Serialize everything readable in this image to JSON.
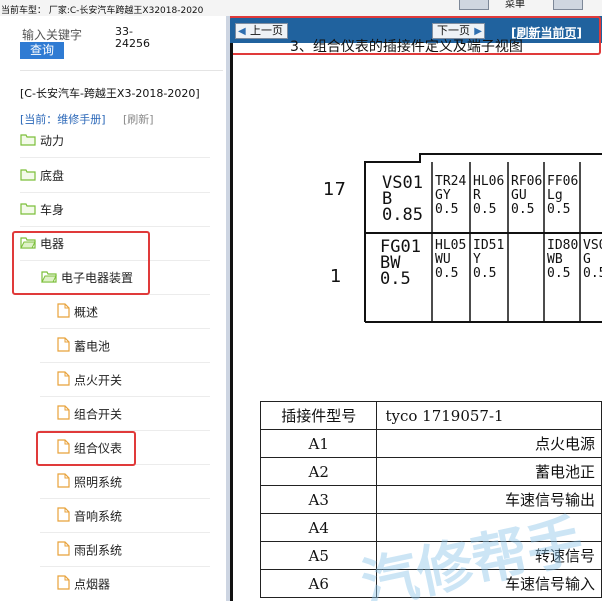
{
  "topbar": {
    "car_line": "当前车型： 厂家:C-长安汽车跨越王X32018-2020",
    "right_label": "菜单"
  },
  "sidebar": {
    "keyword_label": "输入关键字",
    "keyword_value": "33-24256",
    "search_button": "查询",
    "model": "[C-长安汽车-跨越王X3-2018-2020]",
    "current": "[当前：维修手册]",
    "refresh": "[刷新]",
    "items": [
      {
        "label": "动力",
        "level": 0,
        "icon": "folder-icon"
      },
      {
        "label": "底盘",
        "level": 0,
        "icon": "folder-icon"
      },
      {
        "label": "车身",
        "level": 0,
        "icon": "folder-icon"
      },
      {
        "label": "电器",
        "level": 0,
        "icon": "folder-open-icon"
      },
      {
        "label": "电子电器装置",
        "level": 1,
        "icon": "folder-open-icon"
      },
      {
        "label": "概述",
        "level": 2,
        "icon": "document-icon"
      },
      {
        "label": "蓄电池",
        "level": 2,
        "icon": "document-icon"
      },
      {
        "label": "点火开关",
        "level": 2,
        "icon": "document-icon"
      },
      {
        "label": "组合开关",
        "level": 2,
        "icon": "document-icon"
      },
      {
        "label": "组合仪表",
        "level": 2,
        "icon": "document-icon"
      },
      {
        "label": "照明系统",
        "level": 2,
        "icon": "document-icon"
      },
      {
        "label": "音响系统",
        "level": 2,
        "icon": "document-icon"
      },
      {
        "label": "雨刮系统",
        "level": 2,
        "icon": "document-icon"
      },
      {
        "label": "点烟器",
        "level": 2,
        "icon": "document-icon"
      }
    ]
  },
  "content": {
    "prev_button": "上一页",
    "next_button": "下一页",
    "refresh_link": "[刷新当前页]",
    "heading": "3、组合仪表的插接件定义及端子视图",
    "diagram": {
      "row_numbers": [
        "17",
        "1"
      ],
      "top_row": [
        {
          "code": "VS01",
          "color": "B",
          "size": "0.85"
        },
        {
          "code": "TR24",
          "color": "GY",
          "size": "0.5"
        },
        {
          "code": "HL06",
          "color": "R",
          "size": "0.5"
        },
        {
          "code": "RF06",
          "color": "GU",
          "size": "0.5"
        },
        {
          "code": "FF06",
          "color": "Lg",
          "size": "0.5"
        }
      ],
      "bottom_row": [
        {
          "code": "FG01",
          "color": "BW",
          "size": "0.5"
        },
        {
          "code": "HL05",
          "color": "WU",
          "size": "0.5"
        },
        {
          "code": "ID51",
          "color": "Y",
          "size": "0.5"
        },
        {
          "code": "",
          "color": "",
          "size": ""
        },
        {
          "code": "ID80",
          "color": "WB",
          "size": "0.5"
        },
        {
          "code": "VS0",
          "color": "G",
          "size": "0.5"
        }
      ]
    },
    "table": {
      "header": [
        "插接件型号",
        "tyco 1719057-1"
      ],
      "rows": [
        [
          "A1",
          "点火电源"
        ],
        [
          "A2",
          "蓄电池正"
        ],
        [
          "A3",
          "车速信号输出"
        ],
        [
          "A4",
          ""
        ],
        [
          "A5",
          "转速信号"
        ],
        [
          "A6",
          "车速信号输入"
        ]
      ]
    },
    "watermark": "汽修帮手"
  },
  "colors": {
    "navbar": "#20629e",
    "search_button": "#2f7bd3",
    "highlight": "#e03a3a",
    "folder": "#7cbf3a",
    "document": "#e8a23a"
  }
}
